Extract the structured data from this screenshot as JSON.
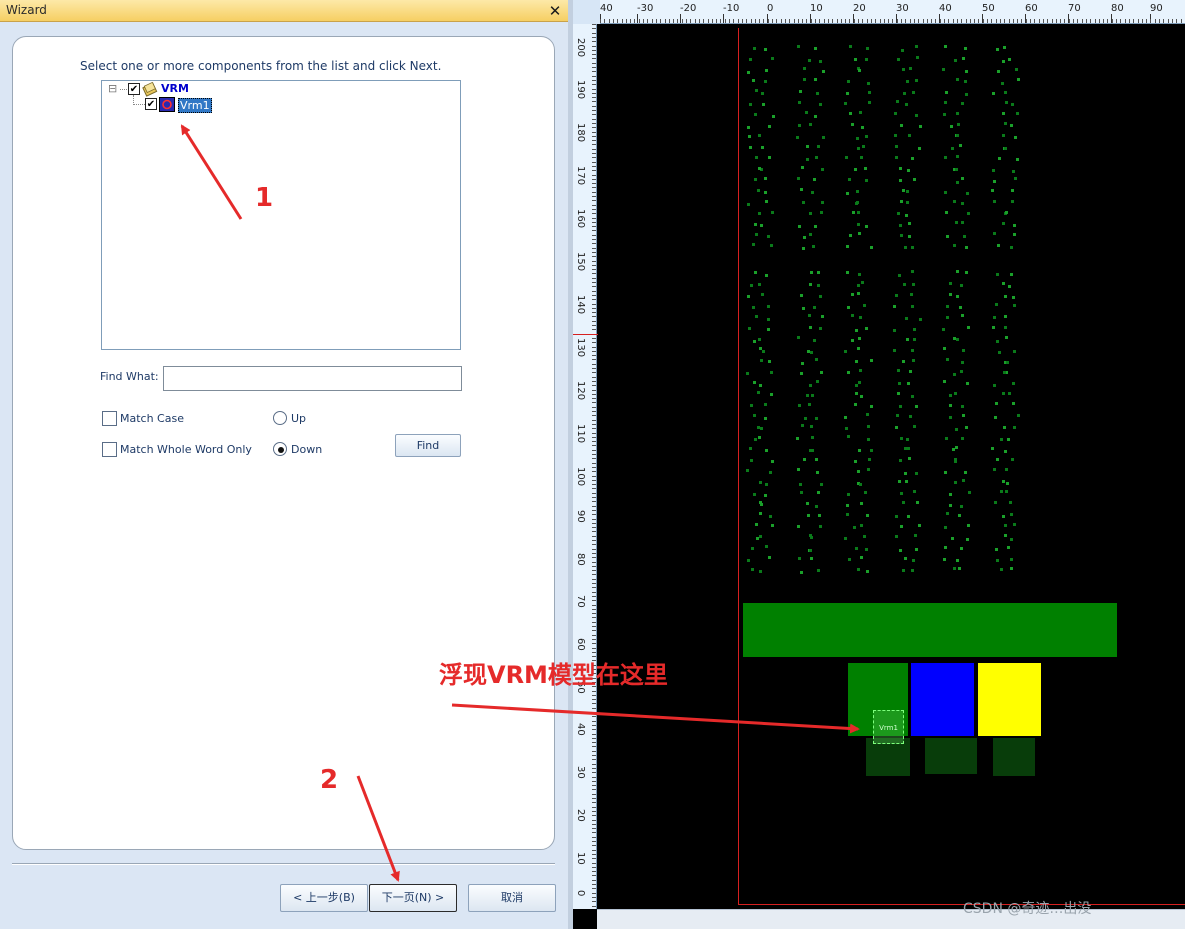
{
  "wizard": {
    "title": "Wizard",
    "close": "✕",
    "instruction": "Select one or more components from the list and click Next.",
    "tree": {
      "root": {
        "label": "VRM",
        "checked": true,
        "expander": "⊟"
      },
      "child": {
        "label": "Vrm1",
        "checked": true,
        "selected": true
      }
    },
    "find_label": "Find What:",
    "find_value": "",
    "options": {
      "match_case": {
        "label": "Match Case",
        "checked": false
      },
      "match_whole_word": {
        "label": "Match Whole Word Only",
        "checked": false
      },
      "up": {
        "label": "Up",
        "selected": false
      },
      "down": {
        "label": "Down",
        "selected": true
      }
    },
    "find_button": "Find",
    "buttons": {
      "back": "< 上一步(B)",
      "next": "下一页(N) >",
      "cancel": "取消"
    }
  },
  "viewer": {
    "h_ruler_ticks": [
      "40",
      "-30",
      "-20",
      "-10",
      "0",
      "10",
      "20",
      "30",
      "40",
      "50",
      "60",
      "70",
      "80",
      "90"
    ],
    "v_ruler_ticks": [
      "200",
      "190",
      "180",
      "170",
      "160",
      "150",
      "140",
      "130",
      "120",
      "110",
      "100",
      "90",
      "80",
      "70",
      "60",
      "50",
      "40",
      "30",
      "20",
      "10",
      "0"
    ],
    "component_label": "Vrm1"
  },
  "annotations": {
    "marker_1": "1",
    "marker_2": "2",
    "callout": "浮现VRM模型在这里",
    "color": "#e52a2a"
  },
  "watermark": "CSDN @奇迹…出没"
}
